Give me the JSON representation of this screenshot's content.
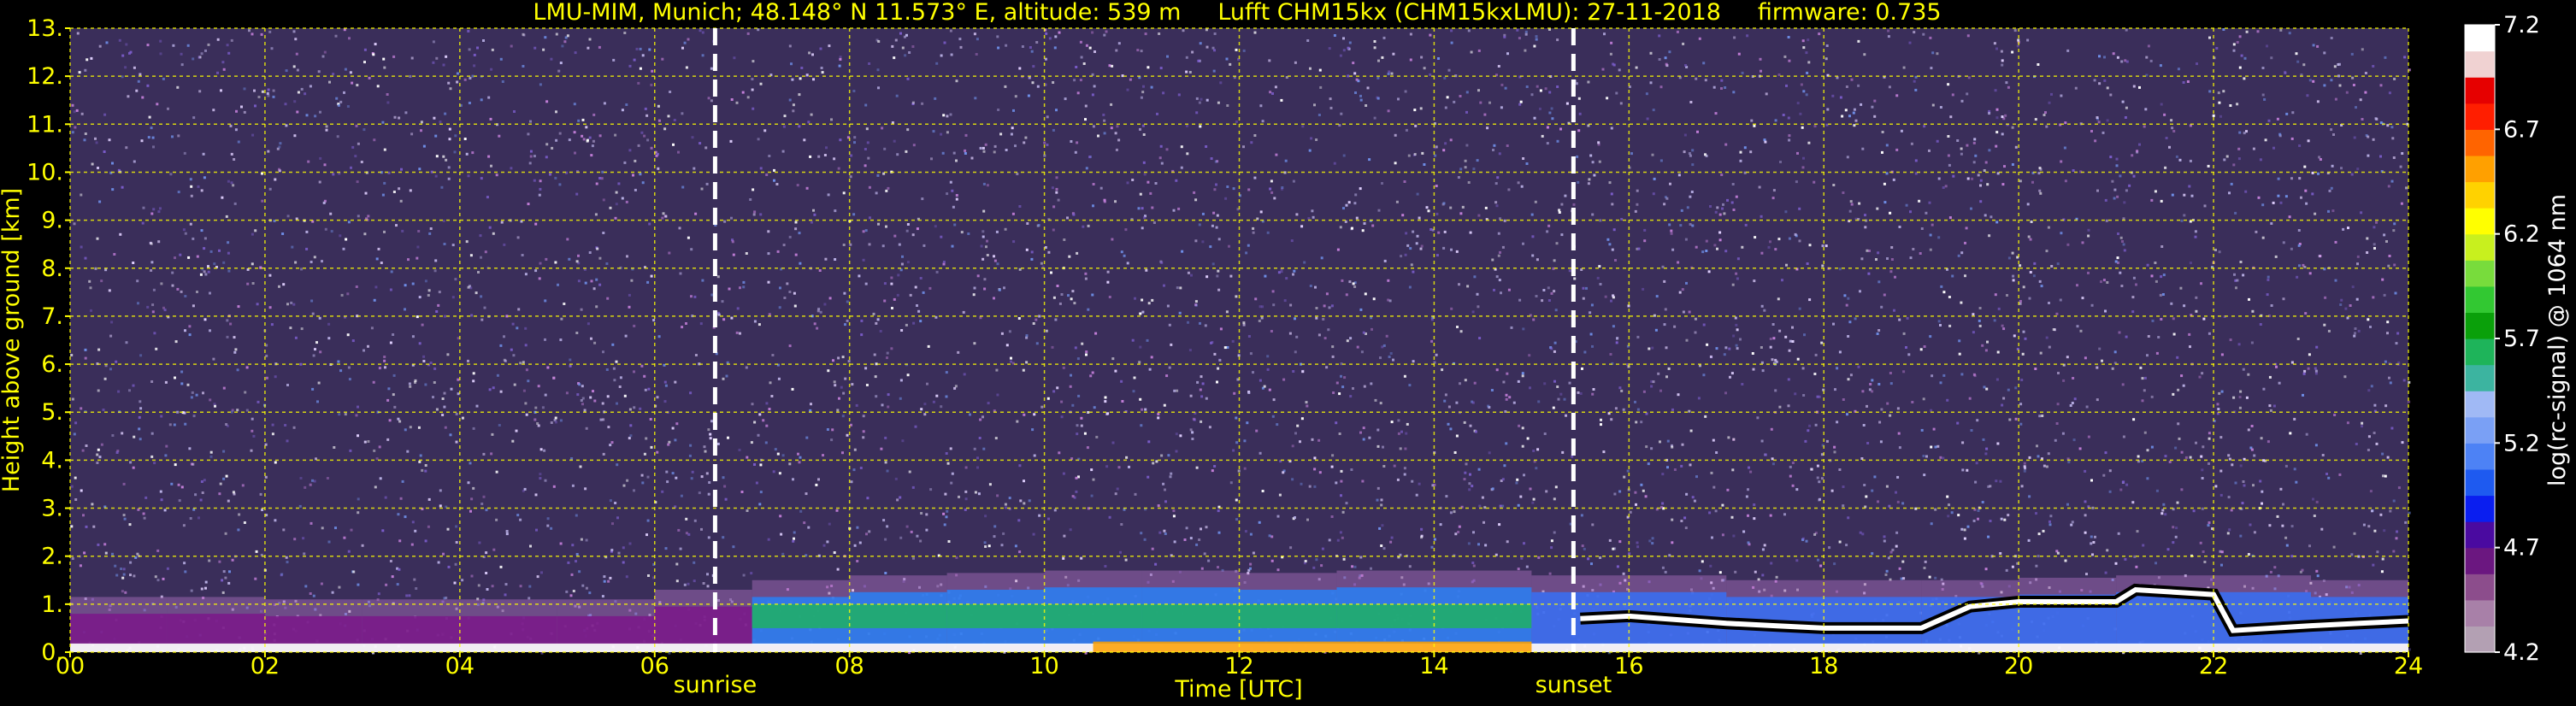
{
  "chart_data": {
    "type": "heatmap",
    "title": "LMU-MIM, Munich; 48.148° N 11.573° E, altitude: 539 m     Lufft CHM15kx (CHM15kxLMU): 27-11-2018     firmware: 0.735",
    "xlabel": "Time [UTC]",
    "ylabel": "Height above ground [km]",
    "colorbar_label": "log(rc-signal) @ 1064 nm",
    "xlim": [
      0,
      24
    ],
    "ylim": [
      0,
      13
    ],
    "x_ticks": [
      "00",
      "02",
      "04",
      "06",
      "08",
      "10",
      "12",
      "14",
      "16",
      "18",
      "20",
      "22",
      "24"
    ],
    "y_ticks": [
      "0.",
      "1.",
      "2.",
      "3.",
      "4.",
      "5.",
      "6.",
      "7.",
      "8.",
      "9.",
      "10.",
      "11.",
      "12.",
      "13."
    ],
    "colorbar_range": [
      4.2,
      7.2
    ],
    "colorbar_ticks": [
      "4.2",
      "4.7",
      "5.2",
      "5.7",
      "6.2",
      "6.7",
      "7.2"
    ],
    "grid": true,
    "annotations": [
      {
        "label": "sunrise",
        "x": 6.62
      },
      {
        "label": "sunset",
        "x": 15.43
      }
    ],
    "boundary_layer_top_km": [
      [
        0.0,
        1.1
      ],
      [
        1.0,
        1.15
      ],
      [
        2.0,
        1.1
      ],
      [
        3.0,
        1.1
      ],
      [
        4.0,
        1.1
      ],
      [
        5.0,
        1.1
      ],
      [
        6.0,
        1.1
      ],
      [
        7.0,
        1.3
      ],
      [
        8.0,
        1.5
      ],
      [
        9.0,
        1.6
      ],
      [
        10.0,
        1.65
      ],
      [
        11.0,
        1.7
      ],
      [
        12.0,
        1.65
      ],
      [
        13.0,
        1.65
      ],
      [
        14.0,
        1.7
      ],
      [
        15.0,
        1.6
      ],
      [
        16.0,
        1.6
      ],
      [
        17.0,
        1.5
      ],
      [
        18.0,
        1.5
      ],
      [
        19.0,
        1.5
      ],
      [
        20.0,
        1.5
      ],
      [
        21.0,
        1.55
      ],
      [
        22.0,
        1.6
      ],
      [
        23.0,
        1.5
      ],
      [
        24.0,
        1.5
      ]
    ],
    "cloud_base_km": [
      [
        15.5,
        0.7
      ],
      [
        16.0,
        0.75
      ],
      [
        17.0,
        0.6
      ],
      [
        17.5,
        0.55
      ],
      [
        18.0,
        0.5
      ],
      [
        19.0,
        0.5
      ],
      [
        19.5,
        0.95
      ],
      [
        20.0,
        1.05
      ],
      [
        21.0,
        1.05
      ],
      [
        21.2,
        1.3
      ],
      [
        22.0,
        1.2
      ],
      [
        22.2,
        0.45
      ],
      [
        23.0,
        0.55
      ],
      [
        23.5,
        0.6
      ],
      [
        24.0,
        0.65
      ]
    ],
    "colorbar_colors": [
      "#b3a0b3",
      "#a880a8",
      "#8c4d8c",
      "#6b1780",
      "#4a0aa0",
      "#0a1ef0",
      "#1e5af0",
      "#4d82f5",
      "#7aa0f5",
      "#a0b9f5",
      "#3cb4a0",
      "#1eb45a",
      "#0aa00a",
      "#32c832",
      "#78dc3c",
      "#c8f01e",
      "#ffff00",
      "#ffd200",
      "#ffa000",
      "#ff6400",
      "#ff1e00",
      "#e60000",
      "#f0d2d2",
      "#ffffff"
    ]
  }
}
